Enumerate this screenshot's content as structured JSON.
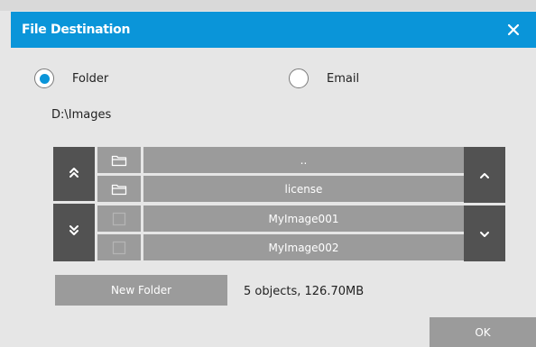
{
  "dialog": {
    "title": "File Destination",
    "close_icon": "close-icon"
  },
  "destination": {
    "options": [
      {
        "label": "Folder",
        "selected": true
      },
      {
        "label": "Email",
        "selected": false
      }
    ],
    "path": "D:\\Images"
  },
  "browser": {
    "items": [
      {
        "name": "..",
        "icon": "folder-icon"
      },
      {
        "name": "license",
        "icon": "folder-icon"
      },
      {
        "name": "MyImage001",
        "icon": "file-icon"
      },
      {
        "name": "MyImage002",
        "icon": "file-icon"
      }
    ],
    "nav_icons": [
      "double-chevron-up-icon",
      "double-chevron-down-icon",
      "chevron-up-icon",
      "chevron-down-icon"
    ]
  },
  "footer": {
    "new_folder_label": "New Folder",
    "status": "5 objects, 126.70MB",
    "ok_label": "OK"
  },
  "colors": {
    "accent": "#0a95d9",
    "button": "#9b9b9b",
    "dark_control": "#525252",
    "background": "#e6e6e6"
  }
}
